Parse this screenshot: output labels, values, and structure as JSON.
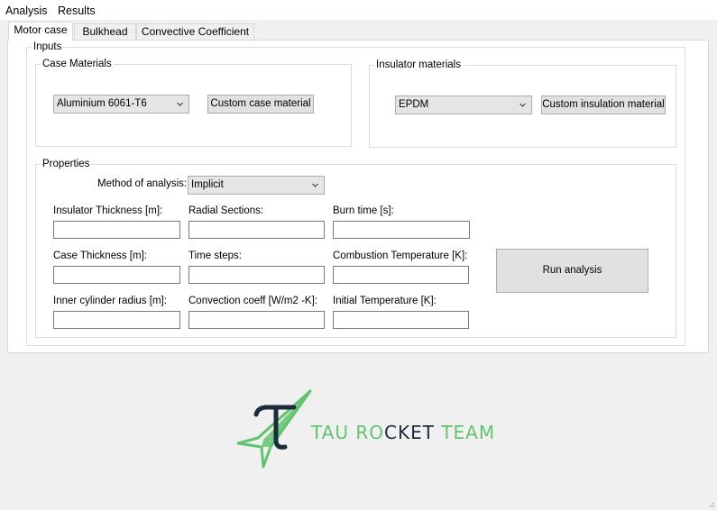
{
  "menu": {
    "items": [
      "Analysis",
      "Results"
    ]
  },
  "tabs": [
    "Motor case",
    "Bulkhead",
    "Convective Coefficient"
  ],
  "inputs_group": {
    "title": "Inputs",
    "case_materials": {
      "title": "Case Materials",
      "selected": "Aluminium 6061-T6",
      "custom_button": "Custom case material"
    },
    "insulator_materials": {
      "title": "Insulator materials",
      "selected": "EPDM",
      "custom_button": "Custom insulation material"
    },
    "properties": {
      "title": "Properties",
      "method_label": "Method of analysis:",
      "method_selected": "Implicit",
      "fields": [
        "Insulator Thickness [m]:",
        "Radial Sections:",
        "Burn time [s]:",
        "Case Thickness [m]:",
        "Time steps:",
        "Combustion Temperature [K]:",
        "Inner cylinder radius [m]:",
        "Convection coeff [W/m2 -K]:",
        "Initial Temperature [K]:"
      ],
      "run_button": "Run analysis"
    }
  },
  "logo": {
    "part1": "TAU RO",
    "part2": "CKET",
    "part3": " TEAM",
    "colors": {
      "green": "#61c46e",
      "dark": "#1b2d3c"
    }
  }
}
